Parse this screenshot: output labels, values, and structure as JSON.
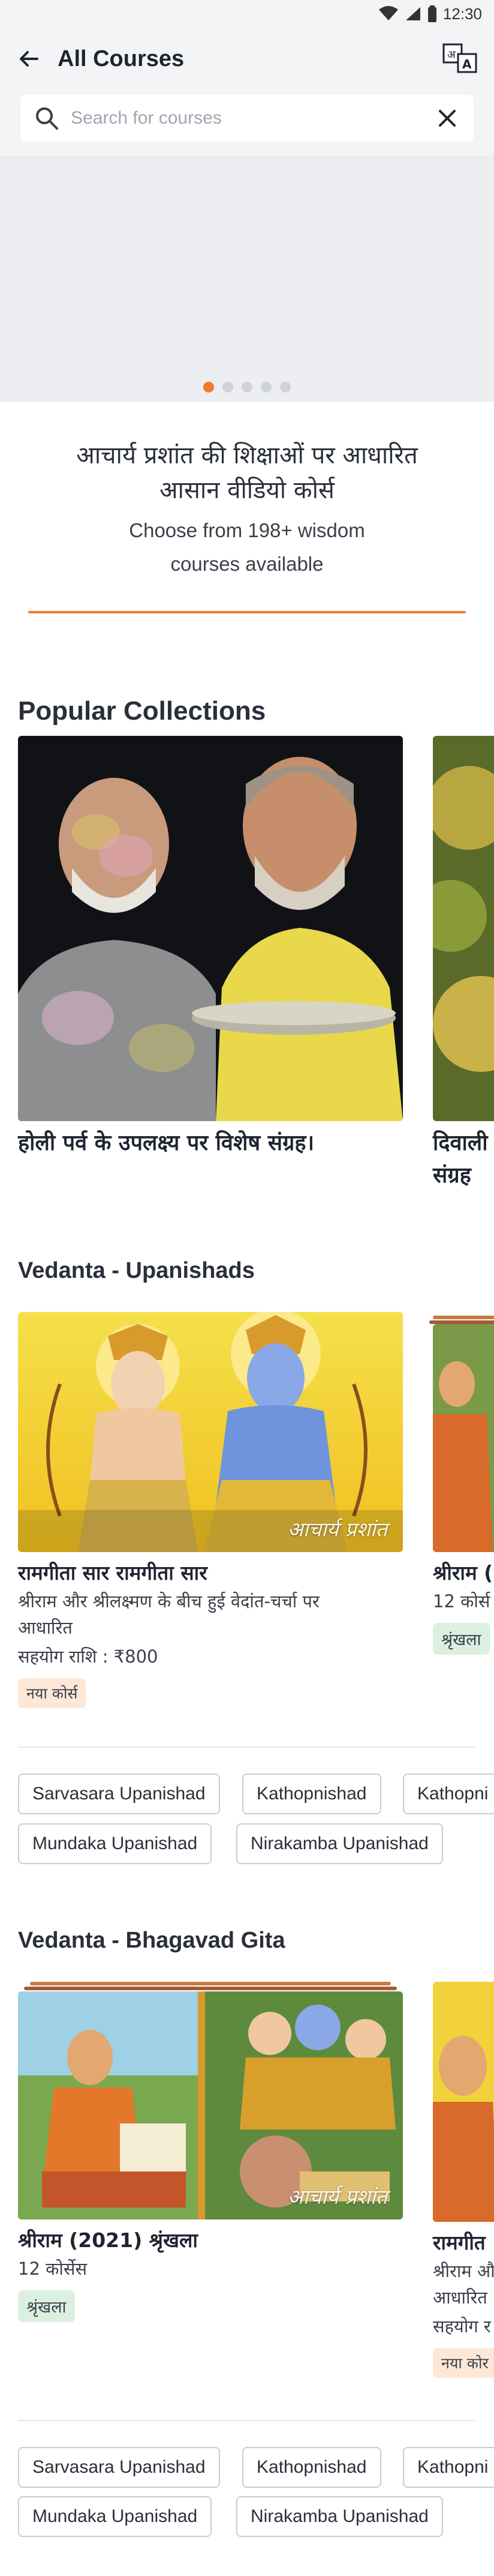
{
  "status_bar": {
    "time": "12:30"
  },
  "app_bar": {
    "title": "All Courses"
  },
  "search": {
    "placeholder": "Search for courses"
  },
  "intro": {
    "hindi_line1": "आचार्य प्रशांत की शिक्षाओं पर आधारित",
    "hindi_line2": "आसान वीडियो कोर्स",
    "sub_line1": "Choose from 198+ wisdom",
    "sub_line2": "courses available"
  },
  "popular": {
    "title": "Popular Collections",
    "cards": [
      {
        "caption": "होली पर्व के उपलक्ष्य पर विशेष संग्रह।"
      },
      {
        "caption_line1": "दिवाली",
        "caption_line2": "संग्रह"
      }
    ]
  },
  "upanishads": {
    "title": "Vedanta - Upanishads",
    "card1": {
      "title": "रामगीता सार रामगीता सार",
      "desc_line1": "श्रीराम और श्रीलक्ष्मण के बीच हुई वेदांत-चर्चा पर",
      "desc_line2": "आधारित",
      "price": "सहयोग राशि : ₹800",
      "badge": "नया कोर्स",
      "watermark": "आचार्य प्रशांत"
    },
    "card2": {
      "title": "श्रीराम (",
      "count": "12 कोर्स",
      "badge": "श्रृंखला"
    },
    "chips": [
      "Sarvasara Upanishad",
      "Kathopnishad",
      "Kathopni",
      "Mundaka Upanishad",
      "Nirakamba Upanishad"
    ]
  },
  "gita": {
    "title": "Vedanta - Bhagavad Gita",
    "card1": {
      "title": "श्रीराम (2021) श्रृंखला",
      "count": "12 कोर्सेस",
      "badge": "श्रृंखला",
      "watermark": "आचार्य प्रशांत"
    },
    "card2": {
      "title": "रामगीत",
      "desc_line1": "श्रीराम औ",
      "desc_line2": "आधारित",
      "price": "सहयोग र",
      "badge": "नया कोर"
    },
    "chips": [
      "Sarvasara Upanishad",
      "Kathopnishad",
      "Kathopni",
      "Mundaka Upanishad",
      "Nirakamba Upanishad"
    ]
  },
  "colors": {
    "accent": "#f07b2c",
    "new_badge": "#fde8d8",
    "series_badge": "#dcf0e2"
  }
}
